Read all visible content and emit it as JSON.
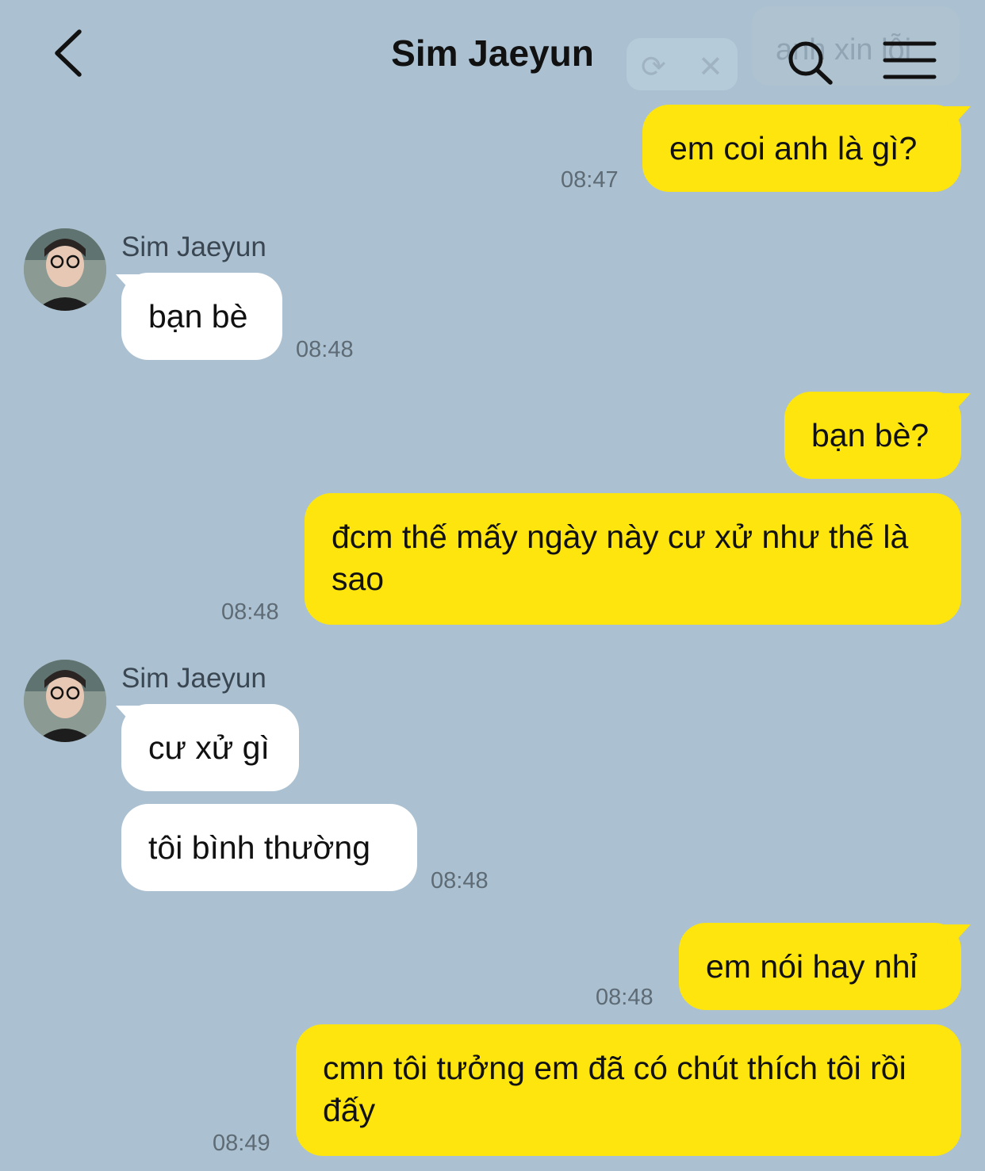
{
  "header": {
    "title": "Sim Jaeyun",
    "ghost_search_text": "anh xin lỗi"
  },
  "messages": [
    {
      "direction": "out",
      "text": "em coi anh là gì?",
      "time": "08:47"
    },
    {
      "direction": "in",
      "sender": "Sim Jaeyun",
      "text": "bạn bè",
      "time": "08:48"
    },
    {
      "direction": "out",
      "text": "bạn bè?",
      "time": ""
    },
    {
      "direction": "out",
      "text": "đcm thế mấy ngày này cư xử như thế là sao",
      "time": "08:48"
    },
    {
      "direction": "in",
      "sender": "Sim Jaeyun",
      "text": "cư xử gì",
      "time": ""
    },
    {
      "direction": "in",
      "text": "tôi bình thường",
      "time": "08:48"
    },
    {
      "direction": "out",
      "text": "em nói hay nhỉ",
      "time": "08:48"
    },
    {
      "direction": "out",
      "text": "cmn tôi tưởng em đã có chút thích tôi rồi đấy",
      "time": "08:49"
    }
  ],
  "colors": {
    "background": "#abc1d1",
    "outgoing_bubble": "#fde50d",
    "incoming_bubble": "#ffffff"
  },
  "icons": [
    "back-arrow-icon",
    "search-icon",
    "menu-icon",
    "refresh-icon",
    "close-icon",
    "avatar"
  ]
}
